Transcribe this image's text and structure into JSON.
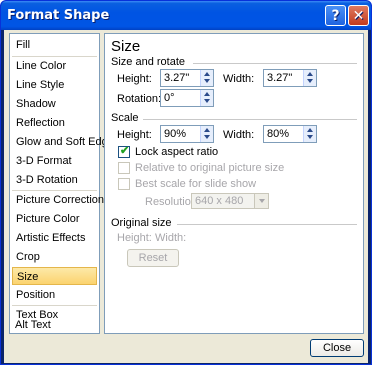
{
  "window": {
    "title": "Format Shape",
    "help_label": "?",
    "close_label": "✕"
  },
  "sidebar": {
    "items": [
      {
        "label": "Fill"
      },
      {
        "label": "Line Color"
      },
      {
        "label": "Line Style"
      },
      {
        "label": "Shadow"
      },
      {
        "label": "Reflection"
      },
      {
        "label": "Glow and Soft Edges"
      },
      {
        "label": "3-D Format"
      },
      {
        "label": "3-D Rotation"
      },
      {
        "label": "Picture Corrections"
      },
      {
        "label": "Picture Color"
      },
      {
        "label": "Artistic Effects"
      },
      {
        "label": "Crop"
      },
      {
        "label": "Size"
      },
      {
        "label": "Position"
      },
      {
        "label": "Text Box"
      },
      {
        "label": "Alt Text"
      }
    ],
    "selected": "Size"
  },
  "panel": {
    "title": "Size",
    "size_rotate": {
      "heading": "Size and rotate",
      "height_label": "Height:",
      "height_value": "3.27\"",
      "width_label": "Width:",
      "width_value": "3.27\"",
      "rotation_label": "Rotation:",
      "rotation_value": "0°"
    },
    "scale": {
      "heading": "Scale",
      "height_label": "Height:",
      "height_value": "90%",
      "width_label": "Width:",
      "width_value": "80%",
      "lock_aspect_label": "Lock aspect ratio",
      "lock_aspect_checked": true,
      "relative_label": "Relative to original picture size",
      "best_scale_label": "Best scale for slide show",
      "resolution_label": "Resolution",
      "resolution_value": "640 x 480"
    },
    "original": {
      "heading": "Original size",
      "height_label": "Height:",
      "width_label": "Width:",
      "reset_label": "Reset"
    }
  },
  "footer": {
    "close_label": "Close"
  },
  "colors": {
    "title_bar": "#0054e3",
    "selected_item": "#fbd36f",
    "dialog_bg": "#ece9d8"
  }
}
